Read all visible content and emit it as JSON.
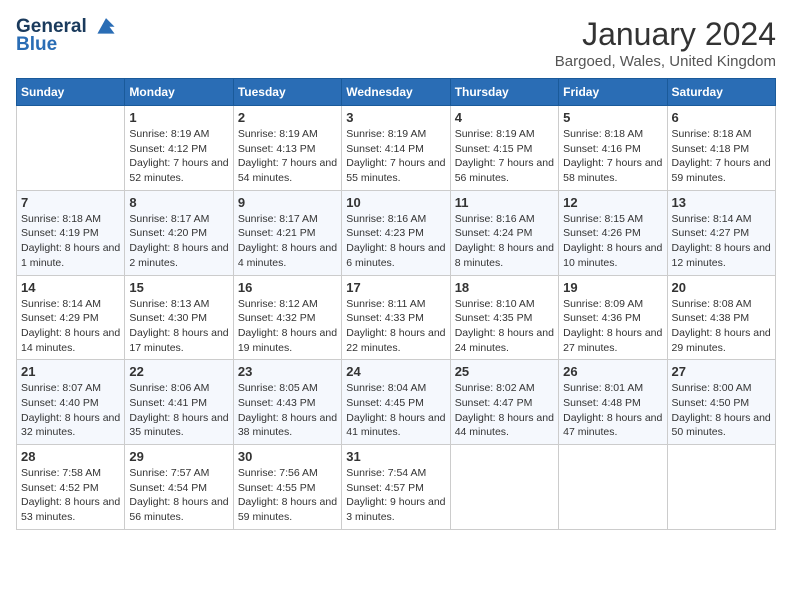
{
  "header": {
    "logo_line1": "General",
    "logo_line2": "Blue",
    "month": "January 2024",
    "location": "Bargoed, Wales, United Kingdom"
  },
  "days_of_week": [
    "Sunday",
    "Monday",
    "Tuesday",
    "Wednesday",
    "Thursday",
    "Friday",
    "Saturday"
  ],
  "weeks": [
    [
      {
        "day": "",
        "sunrise": "",
        "sunset": "",
        "daylight": ""
      },
      {
        "day": "1",
        "sunrise": "Sunrise: 8:19 AM",
        "sunset": "Sunset: 4:12 PM",
        "daylight": "Daylight: 7 hours and 52 minutes."
      },
      {
        "day": "2",
        "sunrise": "Sunrise: 8:19 AM",
        "sunset": "Sunset: 4:13 PM",
        "daylight": "Daylight: 7 hours and 54 minutes."
      },
      {
        "day": "3",
        "sunrise": "Sunrise: 8:19 AM",
        "sunset": "Sunset: 4:14 PM",
        "daylight": "Daylight: 7 hours and 55 minutes."
      },
      {
        "day": "4",
        "sunrise": "Sunrise: 8:19 AM",
        "sunset": "Sunset: 4:15 PM",
        "daylight": "Daylight: 7 hours and 56 minutes."
      },
      {
        "day": "5",
        "sunrise": "Sunrise: 8:18 AM",
        "sunset": "Sunset: 4:16 PM",
        "daylight": "Daylight: 7 hours and 58 minutes."
      },
      {
        "day": "6",
        "sunrise": "Sunrise: 8:18 AM",
        "sunset": "Sunset: 4:18 PM",
        "daylight": "Daylight: 7 hours and 59 minutes."
      }
    ],
    [
      {
        "day": "7",
        "sunrise": "Sunrise: 8:18 AM",
        "sunset": "Sunset: 4:19 PM",
        "daylight": "Daylight: 8 hours and 1 minute."
      },
      {
        "day": "8",
        "sunrise": "Sunrise: 8:17 AM",
        "sunset": "Sunset: 4:20 PM",
        "daylight": "Daylight: 8 hours and 2 minutes."
      },
      {
        "day": "9",
        "sunrise": "Sunrise: 8:17 AM",
        "sunset": "Sunset: 4:21 PM",
        "daylight": "Daylight: 8 hours and 4 minutes."
      },
      {
        "day": "10",
        "sunrise": "Sunrise: 8:16 AM",
        "sunset": "Sunset: 4:23 PM",
        "daylight": "Daylight: 8 hours and 6 minutes."
      },
      {
        "day": "11",
        "sunrise": "Sunrise: 8:16 AM",
        "sunset": "Sunset: 4:24 PM",
        "daylight": "Daylight: 8 hours and 8 minutes."
      },
      {
        "day": "12",
        "sunrise": "Sunrise: 8:15 AM",
        "sunset": "Sunset: 4:26 PM",
        "daylight": "Daylight: 8 hours and 10 minutes."
      },
      {
        "day": "13",
        "sunrise": "Sunrise: 8:14 AM",
        "sunset": "Sunset: 4:27 PM",
        "daylight": "Daylight: 8 hours and 12 minutes."
      }
    ],
    [
      {
        "day": "14",
        "sunrise": "Sunrise: 8:14 AM",
        "sunset": "Sunset: 4:29 PM",
        "daylight": "Daylight: 8 hours and 14 minutes."
      },
      {
        "day": "15",
        "sunrise": "Sunrise: 8:13 AM",
        "sunset": "Sunset: 4:30 PM",
        "daylight": "Daylight: 8 hours and 17 minutes."
      },
      {
        "day": "16",
        "sunrise": "Sunrise: 8:12 AM",
        "sunset": "Sunset: 4:32 PM",
        "daylight": "Daylight: 8 hours and 19 minutes."
      },
      {
        "day": "17",
        "sunrise": "Sunrise: 8:11 AM",
        "sunset": "Sunset: 4:33 PM",
        "daylight": "Daylight: 8 hours and 22 minutes."
      },
      {
        "day": "18",
        "sunrise": "Sunrise: 8:10 AM",
        "sunset": "Sunset: 4:35 PM",
        "daylight": "Daylight: 8 hours and 24 minutes."
      },
      {
        "day": "19",
        "sunrise": "Sunrise: 8:09 AM",
        "sunset": "Sunset: 4:36 PM",
        "daylight": "Daylight: 8 hours and 27 minutes."
      },
      {
        "day": "20",
        "sunrise": "Sunrise: 8:08 AM",
        "sunset": "Sunset: 4:38 PM",
        "daylight": "Daylight: 8 hours and 29 minutes."
      }
    ],
    [
      {
        "day": "21",
        "sunrise": "Sunrise: 8:07 AM",
        "sunset": "Sunset: 4:40 PM",
        "daylight": "Daylight: 8 hours and 32 minutes."
      },
      {
        "day": "22",
        "sunrise": "Sunrise: 8:06 AM",
        "sunset": "Sunset: 4:41 PM",
        "daylight": "Daylight: 8 hours and 35 minutes."
      },
      {
        "day": "23",
        "sunrise": "Sunrise: 8:05 AM",
        "sunset": "Sunset: 4:43 PM",
        "daylight": "Daylight: 8 hours and 38 minutes."
      },
      {
        "day": "24",
        "sunrise": "Sunrise: 8:04 AM",
        "sunset": "Sunset: 4:45 PM",
        "daylight": "Daylight: 8 hours and 41 minutes."
      },
      {
        "day": "25",
        "sunrise": "Sunrise: 8:02 AM",
        "sunset": "Sunset: 4:47 PM",
        "daylight": "Daylight: 8 hours and 44 minutes."
      },
      {
        "day": "26",
        "sunrise": "Sunrise: 8:01 AM",
        "sunset": "Sunset: 4:48 PM",
        "daylight": "Daylight: 8 hours and 47 minutes."
      },
      {
        "day": "27",
        "sunrise": "Sunrise: 8:00 AM",
        "sunset": "Sunset: 4:50 PM",
        "daylight": "Daylight: 8 hours and 50 minutes."
      }
    ],
    [
      {
        "day": "28",
        "sunrise": "Sunrise: 7:58 AM",
        "sunset": "Sunset: 4:52 PM",
        "daylight": "Daylight: 8 hours and 53 minutes."
      },
      {
        "day": "29",
        "sunrise": "Sunrise: 7:57 AM",
        "sunset": "Sunset: 4:54 PM",
        "daylight": "Daylight: 8 hours and 56 minutes."
      },
      {
        "day": "30",
        "sunrise": "Sunrise: 7:56 AM",
        "sunset": "Sunset: 4:55 PM",
        "daylight": "Daylight: 8 hours and 59 minutes."
      },
      {
        "day": "31",
        "sunrise": "Sunrise: 7:54 AM",
        "sunset": "Sunset: 4:57 PM",
        "daylight": "Daylight: 9 hours and 3 minutes."
      },
      {
        "day": "",
        "sunrise": "",
        "sunset": "",
        "daylight": ""
      },
      {
        "day": "",
        "sunrise": "",
        "sunset": "",
        "daylight": ""
      },
      {
        "day": "",
        "sunrise": "",
        "sunset": "",
        "daylight": ""
      }
    ]
  ]
}
